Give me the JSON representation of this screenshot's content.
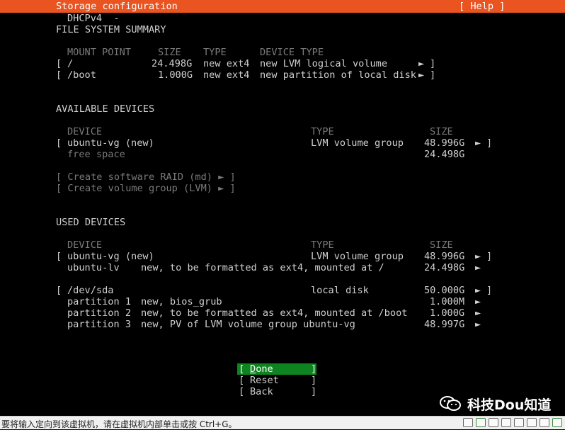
{
  "header": {
    "title": "Storage configuration",
    "help_label": "[ Help ]"
  },
  "network_line": "DHCPv4  -",
  "fs_summary": {
    "heading": "FILE SYSTEM SUMMARY",
    "columns": {
      "mount_point": "MOUNT POINT",
      "size": "SIZE",
      "type": "TYPE",
      "device_type": "DEVICE TYPE"
    },
    "rows": [
      {
        "bracket_open": "[",
        "mount": "/",
        "size": "24.498G",
        "type": "new ext4",
        "device_type": "new LVM logical volume",
        "arrow": "►",
        "bracket_close": "]"
      },
      {
        "bracket_open": "[",
        "mount": "/boot",
        "size": "1.000G",
        "type": "new ext4",
        "device_type": "new partition of local disk",
        "arrow": "►",
        "bracket_close": "]"
      }
    ]
  },
  "available_devices": {
    "heading": "AVAILABLE DEVICES",
    "columns": {
      "device": "DEVICE",
      "type": "TYPE",
      "size": "SIZE"
    },
    "rows": [
      {
        "bracket_open": "[",
        "device": "ubuntu-vg (new)",
        "type": "LVM volume group",
        "size": "48.996G",
        "arrow": "►",
        "bracket_close": "]"
      },
      {
        "device": "free space",
        "size": "24.498G"
      }
    ],
    "actions": [
      "[ Create software RAID (md) ► ]",
      "[ Create volume group (LVM) ► ]"
    ]
  },
  "used_devices": {
    "heading": "USED DEVICES",
    "columns": {
      "device": "DEVICE",
      "type": "TYPE",
      "size": "SIZE"
    },
    "rows": [
      {
        "bracket_open": "[",
        "device": "ubuntu-vg (new)",
        "type": "LVM volume group",
        "size": "48.996G",
        "arrow": "►",
        "bracket_close": "]"
      },
      {
        "device": "ubuntu-lv",
        "desc": "new, to be formatted as ext4, mounted at /",
        "size": "24.498G",
        "arrow": "►"
      },
      {
        "bracket_open": "[",
        "device": "/dev/sda",
        "type": "local disk",
        "size": "50.000G",
        "arrow": "►",
        "bracket_close": "]"
      },
      {
        "device": "partition 1",
        "desc": "new, bios_grub",
        "size": "1.000M",
        "arrow": "►"
      },
      {
        "device": "partition 2",
        "desc": "new, to be formatted as ext4, mounted at /boot",
        "size": "1.000G",
        "arrow": "►"
      },
      {
        "device": "partition 3",
        "desc": "new, PV of LVM volume group ubuntu-vg",
        "size": "48.997G",
        "arrow": "►"
      }
    ]
  },
  "buttons": {
    "done": {
      "open": "[ ",
      "hotkey": "D",
      "rest": "one",
      "close": "]"
    },
    "reset": {
      "open": "[ ",
      "label": "Reset",
      "close": "]"
    },
    "back": {
      "open": "[ ",
      "label": "Back",
      "close": "]"
    }
  },
  "statusbar": {
    "message": "要将输入定向到该虚拟机，请在虚拟机内部单击或按 Ctrl+G。"
  },
  "watermark": {
    "text": "科技Dou知道",
    "icon": "wechat-icon"
  },
  "colors": {
    "title_bar": "#e95420",
    "selected_button": "#0e8420",
    "background": "#000000",
    "text": "#d0d0d0",
    "dim_text": "#7a7a7a"
  }
}
